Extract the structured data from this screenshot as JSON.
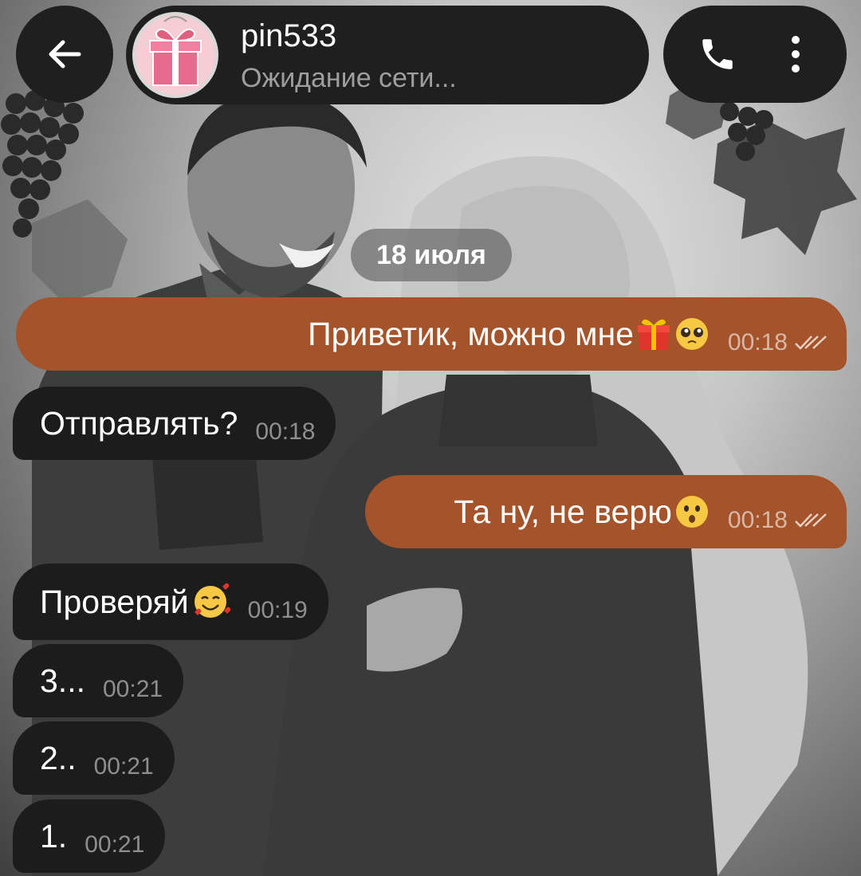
{
  "header": {
    "back_icon": "arrow-left-icon",
    "contact_name": "pin533",
    "status": "Ожидание сети...",
    "avatar_icon": "gift-box-icon",
    "call_icon": "phone-icon",
    "menu_icon": "more-vertical-icon"
  },
  "chat": {
    "date_separator": "18 июля",
    "messages": [
      {
        "direction": "outgoing",
        "text": "Приветик, можно мне",
        "emojis": [
          "gift-emoji",
          "pleading-face-emoji"
        ],
        "time": "00:18",
        "status_icon": "double-check-icon"
      },
      {
        "direction": "incoming",
        "text": "Отправлять?",
        "time": "00:18"
      },
      {
        "direction": "outgoing",
        "text": "Та ну, не верю ",
        "emojis": [
          "hushed-face-emoji"
        ],
        "time": "00:18",
        "status_icon": "double-check-icon"
      },
      {
        "direction": "incoming",
        "text": "Проверяй",
        "emojis": [
          "smiling-face-with-hearts-emoji"
        ],
        "time": "00:19"
      },
      {
        "direction": "incoming",
        "text": "3...",
        "time": "00:21"
      },
      {
        "direction": "incoming",
        "text": "2..",
        "time": "00:21"
      },
      {
        "direction": "incoming",
        "text": "1.",
        "time": "00:21"
      }
    ]
  },
  "colors": {
    "outgoing_bubble": "#a4532a",
    "incoming_bubble": "#1c1c1c",
    "bar_background": "#1f1f1f",
    "status_text": "#9e9e9e"
  }
}
